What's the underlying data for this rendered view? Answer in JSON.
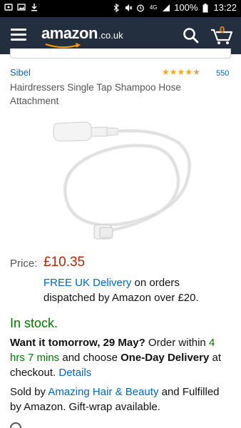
{
  "status_bar": {
    "battery": "100%",
    "time": "13:22",
    "network": "4G"
  },
  "header": {
    "logo_main": "amazon",
    "logo_tld": ".co.uk",
    "cart_count": "0"
  },
  "product": {
    "brand": "Sibel",
    "rating": 4.5,
    "review_count": "550",
    "title": "Hairdressers Single Tap Shampoo Hose Attachment"
  },
  "price": {
    "label": "Price:",
    "value": "£10.35"
  },
  "delivery": {
    "free_label": "FREE UK Delivery",
    "rest": " on orders dispatched by Amazon over £20."
  },
  "stock": {
    "status": "In stock."
  },
  "dispatch": {
    "want_it": "Want it tomorrow, 29 May?",
    "order_within": " Order within ",
    "countdown": "4 hrs 7 mins",
    "and_choose": " and choose ",
    "delivery_option": "One-Day Delivery",
    "at_checkout": " at checkout. ",
    "details_link": "Details"
  },
  "seller": {
    "sold_by": "Sold by ",
    "seller_name": "Amazing Hair & Beauty",
    "fulfilled": " and Fulfilled by Amazon. Gift-wrap available."
  },
  "colors": {
    "header_bg": "#232f3e",
    "link": "#0066c0",
    "price": "#b12704",
    "in_stock": "#007600",
    "star": "#ffa41c",
    "cart_count": "#f08804"
  }
}
